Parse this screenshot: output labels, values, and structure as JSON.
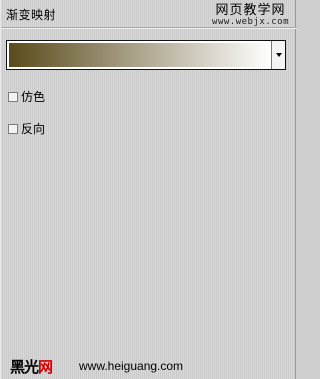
{
  "panel": {
    "title": "渐变映射"
  },
  "watermark": {
    "cn": "网页教学网",
    "url": "www.webjx.com"
  },
  "gradient": {
    "start_color": "#5a4b1c",
    "end_color": "#ffffff"
  },
  "options": [
    {
      "label": "仿色",
      "checked": false
    },
    {
      "label": "反向",
      "checked": false
    }
  ],
  "footer": {
    "logo_black": "黑光",
    "logo_red": "网",
    "url": "www.heiguang.com"
  }
}
